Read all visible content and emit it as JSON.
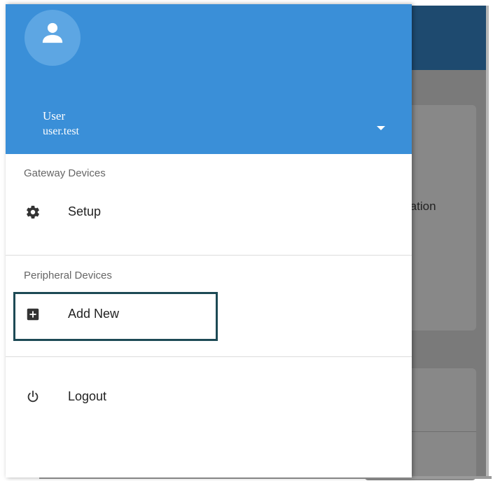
{
  "background": {
    "partial_text": "ration"
  },
  "drawer": {
    "header": {
      "user_name": "User",
      "user_id": "user.test",
      "avatar_icon": "person-icon",
      "account_switch_icon": "arrow-drop-down-icon",
      "bg_color": "#3a8fd8"
    },
    "sections": [
      {
        "title": "Gateway Devices",
        "items": [
          {
            "label": "Setup",
            "icon": "gear-icon"
          }
        ]
      },
      {
        "title": "Peripheral Devices",
        "items": [
          {
            "label": "Add New",
            "icon": "add-box-icon"
          }
        ]
      }
    ],
    "footer_items": [
      {
        "label": "Logout",
        "icon": "power-icon"
      }
    ]
  },
  "colors": {
    "accent": "#3a8fd8",
    "appbar": "#1e4a6f",
    "highlight_border": "#1d4a55"
  }
}
